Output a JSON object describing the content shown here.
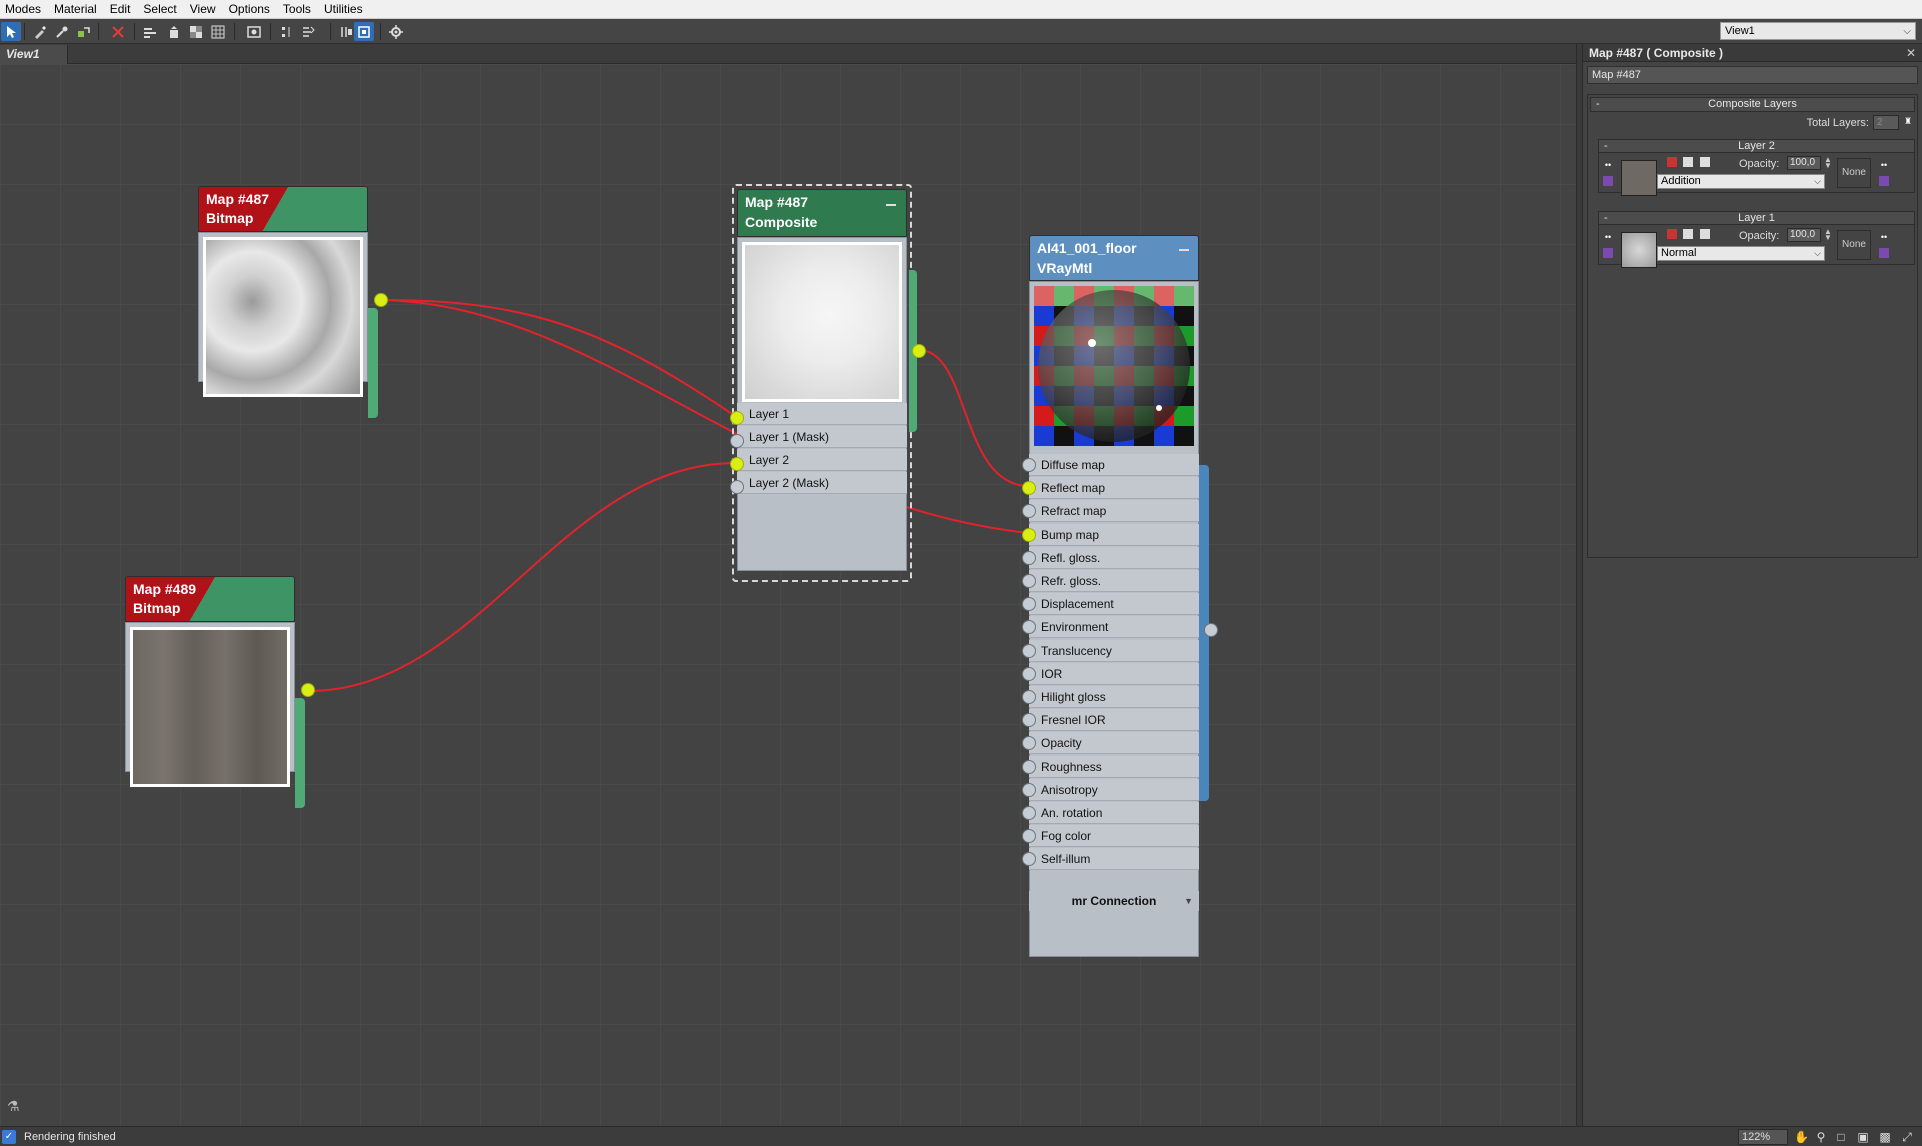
{
  "menu": [
    "Modes",
    "Material",
    "Edit",
    "Select",
    "View",
    "Options",
    "Tools",
    "Utilities"
  ],
  "toolbar": {
    "view_select": "View1",
    "icons": [
      "select-icon",
      "pick-icon",
      "pipette-icon",
      "assign-icon",
      "delete-icon",
      "layout-icon",
      "layout-children-icon",
      "show-map-icon",
      "show-background-icon",
      "render-icon",
      "move-children-icon",
      "hide-unused-icon",
      "layout-all-icon",
      "nav-lock-icon",
      "options-icon"
    ]
  },
  "tab": {
    "label": "View1"
  },
  "nodes": {
    "bitmap487": {
      "title": "Map #487",
      "subtitle": "Bitmap"
    },
    "bitmap489": {
      "title": "Map #489",
      "subtitle": "Bitmap"
    },
    "composite": {
      "title": "Map #487",
      "subtitle": "Composite",
      "slots": [
        "Layer 1",
        "Layer 1 (Mask)",
        "Layer 2",
        "Layer 2 (Mask)"
      ],
      "slot_connected": [
        true,
        false,
        true,
        false
      ]
    },
    "vraymtl": {
      "title": "AI41_001_floor",
      "subtitle": "VRayMtl",
      "slots": [
        "Diffuse map",
        "Reflect map",
        "Refract map",
        "Bump map",
        "Refl. gloss.",
        "Refr. gloss.",
        "Displacement",
        "Environment",
        "Translucency",
        "IOR",
        "Hilight gloss",
        "Fresnel IOR",
        "Opacity",
        "Roughness",
        "Anisotropy",
        "An. rotation",
        "Fog color",
        "Self-illum"
      ],
      "slot_connected": [
        false,
        true,
        false,
        true,
        false,
        false,
        false,
        false,
        false,
        false,
        false,
        false,
        false,
        false,
        false,
        false,
        false,
        false
      ],
      "footer": "mr Connection"
    }
  },
  "panel": {
    "title": "Map #487  ( Composite )",
    "map_name": "Map #487",
    "rollout_title": "Composite Layers",
    "total_layers_label": "Total Layers:",
    "total_layers_value": "2",
    "layers": [
      {
        "name": "Layer 2",
        "opacity_label": "Opacity:",
        "opacity": "100,0",
        "blend_mode": "Addition",
        "mask": "None"
      },
      {
        "name": "Layer 1",
        "opacity_label": "Opacity:",
        "opacity": "100,0",
        "blend_mode": "Normal",
        "mask": "None"
      }
    ]
  },
  "status": {
    "text": "Rendering finished",
    "zoom": "122%"
  },
  "colors": {
    "bitmap_header": "#b01218",
    "map_green": "#3f9466",
    "material_blue": "#5d8fc0",
    "wire": "#e2232b",
    "socket_on": "#d8ee14",
    "selected_toolbar": "#2f6eb5"
  }
}
